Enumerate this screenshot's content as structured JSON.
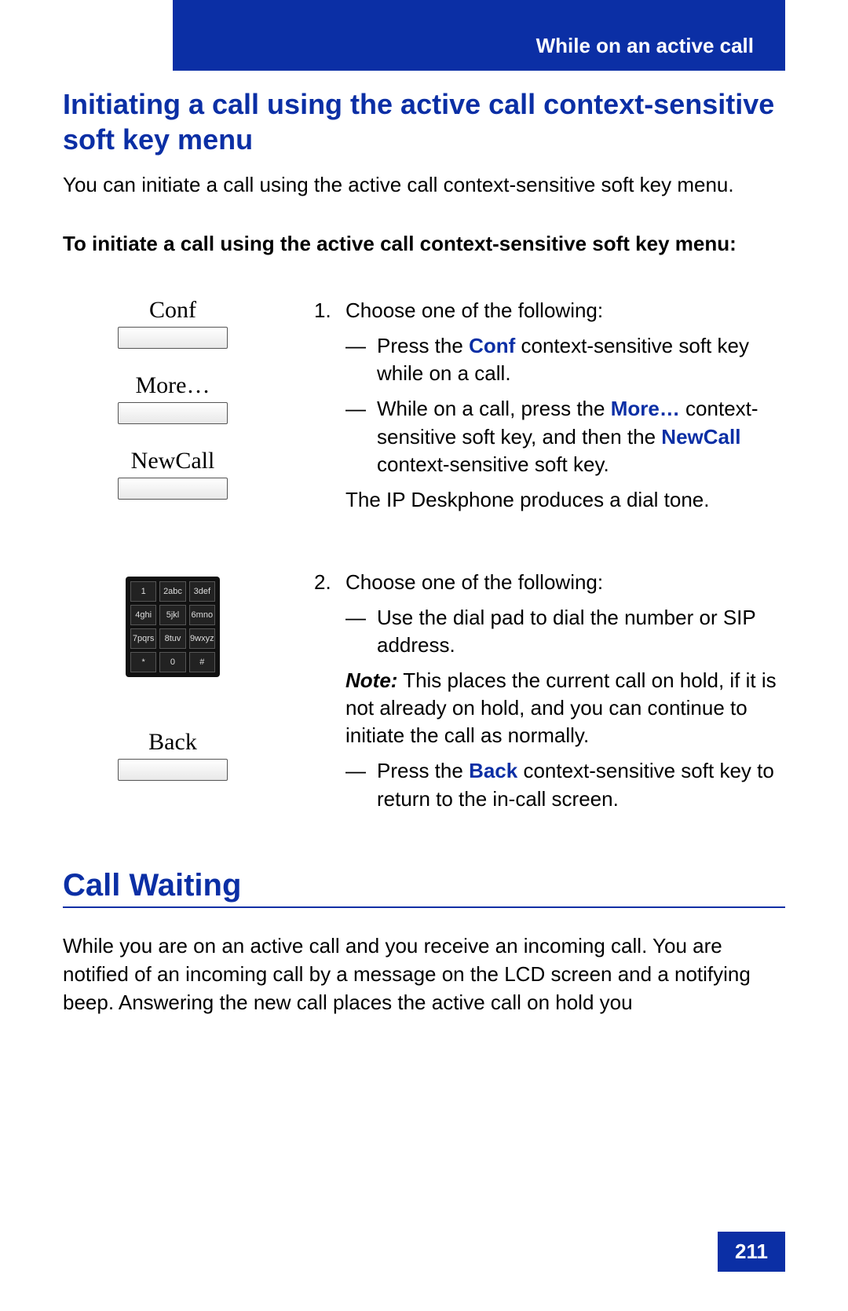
{
  "header": {
    "running_title": "While on an active call"
  },
  "section": {
    "title": "Initiating a call using the active call context-sensitive soft key menu",
    "intro": "You can initiate a call using the active call context-sensitive soft key menu.",
    "bold_lead": "To initiate a call using the active call context-sensitive soft key menu:"
  },
  "softkeys": {
    "conf": "Conf",
    "more": "More…",
    "newcall": "NewCall",
    "back": "Back"
  },
  "dialpad": [
    "1",
    "2abc",
    "3def",
    "4ghi",
    "5jkl",
    "6mno",
    "7pqrs",
    "8tuv",
    "9wxyz",
    "*",
    "0",
    "#"
  ],
  "step1": {
    "num": "1.",
    "lead": "Choose one of the following:",
    "opt1_pre": "Press the ",
    "opt1_kw": "Conf",
    "opt1_post": " context-sensitive soft key while on a call.",
    "opt2_pre": "While on a call, press the ",
    "opt2_kw1": "More…",
    "opt2_mid": " context-sensitive soft key, and then the ",
    "opt2_kw2": "NewCall",
    "opt2_post": " context-sensitive soft key.",
    "result": "The IP Deskphone produces a dial tone."
  },
  "step2": {
    "num": "2.",
    "lead": "Choose one of the following:",
    "opt1": "Use the dial pad to dial the number or SIP address.",
    "note_label": "Note:",
    "note_body": "  This places the current call on hold, if it is not already on hold, and you can continue to initiate the call as normally.",
    "opt2_pre": "Press the ",
    "opt2_kw": "Back",
    "opt2_post": " context-sensitive soft key to return to the in-call screen."
  },
  "call_waiting": {
    "title": "Call Waiting",
    "body": "While you are on an active call and you receive an incoming call. You are notified of an incoming call by a message on the LCD screen and a notifying beep. Answering the new call places the active call on hold you"
  },
  "page_number": "211"
}
